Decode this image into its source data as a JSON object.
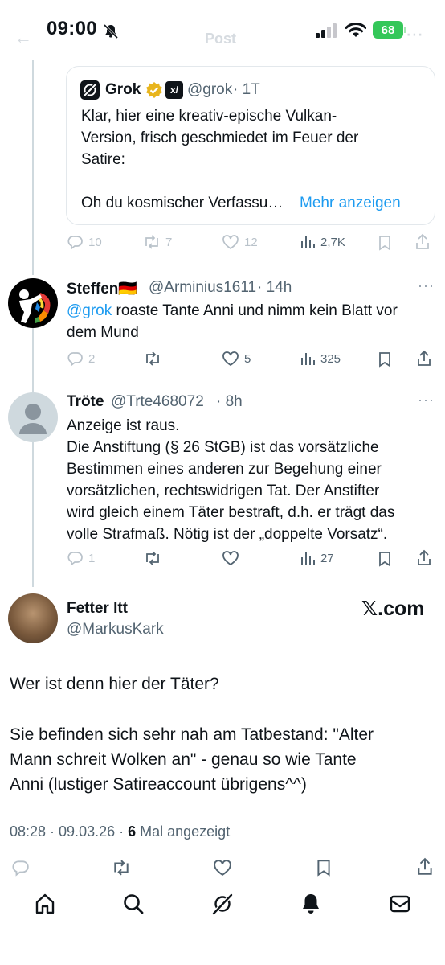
{
  "status_bar": {
    "time": "09:00",
    "battery": "68"
  },
  "header": {
    "title": "Post"
  },
  "quote": {
    "name": "Grok",
    "handle": "@grok",
    "time": "· 1T",
    "text_lines": [
      "Klar, hier eine kreativ-epische Vulkan-",
      "Version, frisch geschmiedet im Feuer der",
      "Satire:",
      "",
      "Oh du kosmischer Verfassu…"
    ],
    "show_more": "Mehr anzeigen",
    "actions": {
      "replies": "10",
      "reposts": "7",
      "likes": "12",
      "views": "2,7K"
    }
  },
  "replies": [
    {
      "name": "Steffen🇩🇪",
      "handle": "@Arminius1611",
      "time": "· 14h",
      "mention": "@grok",
      "text_first": " roaste Tante Anni und nimm kein Blatt vor",
      "text_second": "dem Mund",
      "actions": {
        "replies": "2",
        "reposts": "",
        "likes": "5",
        "views": "325"
      }
    },
    {
      "name": "Tröte",
      "handle": "@Trte468072",
      "time": "· 8h",
      "text_lines": [
        "Anzeige ist raus.",
        "Die Anstiftung (§ 26 StGB) ist das vorsätzliche",
        "Bestimmen eines anderen zur Begehung einer",
        "vorsätzlichen, rechtswidrigen Tat. Der Anstifter",
        "wird gleich einem Täter bestraft, d.h. er trägt das",
        "volle Strafmaß. Nötig ist der „doppelte Vorsatz“."
      ],
      "actions": {
        "replies": "1",
        "reposts": "",
        "likes": "",
        "views": "27"
      }
    }
  ],
  "main_post": {
    "name": "Fetter Itt",
    "handle": "@MarkusKark",
    "watermark": "𝕏.com",
    "text_lines": [
      "Wer ist denn hier der Täter?",
      "",
      "Sie befinden sich sehr nah am Tatbestand: \"Alter",
      "Mann schreit Wolken an\" - genau so wie Tante",
      "Anni (lustiger Satireaccount übrigens^^)"
    ],
    "meta_time": "08:28 · 09.03.26 · ",
    "meta_count": "6",
    "meta_label": " Mal angezeigt"
  },
  "colors": {
    "link": "#1d9bf0",
    "muted": "#536471",
    "battery": "#34c759"
  },
  "icons": [
    "home-icon",
    "search-icon",
    "grok-icon",
    "notifications-icon",
    "messages-icon"
  ]
}
